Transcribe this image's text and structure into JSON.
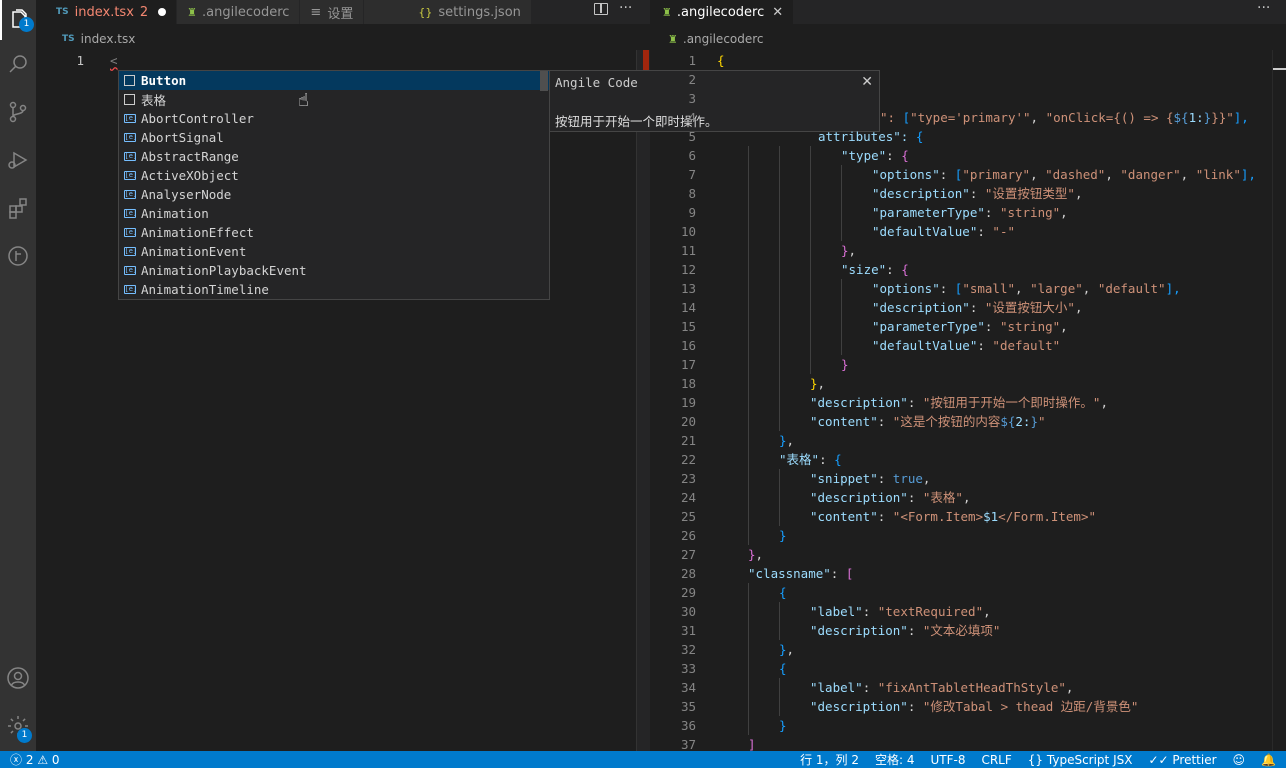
{
  "activity_bar": {
    "explorer_badge": "1",
    "settings_badge": "1"
  },
  "left_editor": {
    "tabs": [
      {
        "icon": "TS",
        "label": "index.tsx",
        "problems": "2"
      },
      {
        "label": ".angilecoderc"
      },
      {
        "icon": "≡",
        "label": "设置"
      },
      {
        "icon": "{}",
        "label": "settings.json"
      }
    ],
    "breadcrumb": {
      "icon": "TS",
      "label": "index.tsx"
    },
    "line_number": "1",
    "code": "<"
  },
  "suggest_widget": {
    "items": [
      {
        "label": "Button",
        "kind": "snippet"
      },
      {
        "label": "表格",
        "kind": "snippet"
      },
      {
        "label": "AbortController",
        "kind": "variable"
      },
      {
        "label": "AbortSignal",
        "kind": "variable"
      },
      {
        "label": "AbstractRange",
        "kind": "variable"
      },
      {
        "label": "ActiveXObject",
        "kind": "variable"
      },
      {
        "label": "AnalyserNode",
        "kind": "variable"
      },
      {
        "label": "Animation",
        "kind": "variable"
      },
      {
        "label": "AnimationEffect",
        "kind": "variable"
      },
      {
        "label": "AnimationEvent",
        "kind": "variable"
      },
      {
        "label": "AnimationPlaybackEvent",
        "kind": "variable"
      },
      {
        "label": "AnimationTimeline",
        "kind": "variable"
      }
    ],
    "detail": {
      "title": "Angile Code",
      "description": "按钮用于开始一个即时操作。"
    }
  },
  "right_editor": {
    "tab": {
      "label": ".angilecoderc"
    },
    "breadcrumb": ".angilecoderc",
    "lines": [
      {
        "n": "1",
        "indent": 0,
        "tokens": [
          [
            "{",
            "#ffd700"
          ]
        ]
      },
      {
        "n": "2",
        "indent": 0,
        "tokens": []
      },
      {
        "n": "3",
        "indent": 0,
        "tokens": []
      },
      {
        "n": "4",
        "indent": 0,
        "tokens": [
          [
            "\": ",
            "#ce9178"
          ],
          [
            "[",
            "#179fff"
          ],
          [
            "\"type='primary'\"",
            "#ce9178"
          ],
          [
            ", ",
            "#d4d4d4"
          ],
          [
            "\"onClick={() => {",
            "#ce9178"
          ],
          [
            "${",
            "#569cd6"
          ],
          [
            "1:",
            "#9cdcfe"
          ],
          [
            "}",
            "#569cd6"
          ],
          [
            "}}\"",
            "#ce9178"
          ],
          [
            "],",
            "#179fff"
          ]
        ]
      },
      {
        "n": "5",
        "indent": 0,
        "tokens": [
          [
            "attributes\": ",
            "#9cdcfe"
          ],
          [
            "{",
            "#179fff"
          ]
        ]
      },
      {
        "n": "6",
        "indent": 4,
        "tokens": [
          [
            "\"type\"",
            "#9cdcfe"
          ],
          [
            ": ",
            "#d4d4d4"
          ],
          [
            "{",
            "#da70d6"
          ]
        ]
      },
      {
        "n": "7",
        "indent": 5,
        "tokens": [
          [
            "\"options\"",
            "#9cdcfe"
          ],
          [
            ": ",
            "#d4d4d4"
          ],
          [
            "[",
            "#179fff"
          ],
          [
            "\"primary\"",
            "#ce9178"
          ],
          [
            ", ",
            "#d4d4d4"
          ],
          [
            "\"dashed\"",
            "#ce9178"
          ],
          [
            ", ",
            "#d4d4d4"
          ],
          [
            "\"danger\"",
            "#ce9178"
          ],
          [
            ", ",
            "#d4d4d4"
          ],
          [
            "\"link\"",
            "#ce9178"
          ],
          [
            "],",
            "#179fff"
          ]
        ]
      },
      {
        "n": "8",
        "indent": 5,
        "tokens": [
          [
            "\"description\"",
            "#9cdcfe"
          ],
          [
            ": ",
            "#d4d4d4"
          ],
          [
            "\"设置按钮类型\"",
            "#ce9178"
          ],
          [
            ",",
            "#d4d4d4"
          ]
        ]
      },
      {
        "n": "9",
        "indent": 5,
        "tokens": [
          [
            "\"parameterType\"",
            "#9cdcfe"
          ],
          [
            ": ",
            "#d4d4d4"
          ],
          [
            "\"string\"",
            "#ce9178"
          ],
          [
            ",",
            "#d4d4d4"
          ]
        ]
      },
      {
        "n": "10",
        "indent": 5,
        "tokens": [
          [
            "\"defaultValue\"",
            "#9cdcfe"
          ],
          [
            ": ",
            "#d4d4d4"
          ],
          [
            "\"-\"",
            "#ce9178"
          ]
        ]
      },
      {
        "n": "11",
        "indent": 4,
        "tokens": [
          [
            "}",
            "#da70d6"
          ],
          [
            ",",
            "#d4d4d4"
          ]
        ]
      },
      {
        "n": "12",
        "indent": 4,
        "tokens": [
          [
            "\"size\"",
            "#9cdcfe"
          ],
          [
            ": ",
            "#d4d4d4"
          ],
          [
            "{",
            "#da70d6"
          ]
        ]
      },
      {
        "n": "13",
        "indent": 5,
        "tokens": [
          [
            "\"options\"",
            "#9cdcfe"
          ],
          [
            ": ",
            "#d4d4d4"
          ],
          [
            "[",
            "#179fff"
          ],
          [
            "\"small\"",
            "#ce9178"
          ],
          [
            ", ",
            "#d4d4d4"
          ],
          [
            "\"large\"",
            "#ce9178"
          ],
          [
            ", ",
            "#d4d4d4"
          ],
          [
            "\"default\"",
            "#ce9178"
          ],
          [
            "],",
            "#179fff"
          ]
        ]
      },
      {
        "n": "14",
        "indent": 5,
        "tokens": [
          [
            "\"description\"",
            "#9cdcfe"
          ],
          [
            ": ",
            "#d4d4d4"
          ],
          [
            "\"设置按钮大小\"",
            "#ce9178"
          ],
          [
            ",",
            "#d4d4d4"
          ]
        ]
      },
      {
        "n": "15",
        "indent": 5,
        "tokens": [
          [
            "\"parameterType\"",
            "#9cdcfe"
          ],
          [
            ": ",
            "#d4d4d4"
          ],
          [
            "\"string\"",
            "#ce9178"
          ],
          [
            ",",
            "#d4d4d4"
          ]
        ]
      },
      {
        "n": "16",
        "indent": 5,
        "tokens": [
          [
            "\"defaultValue\"",
            "#9cdcfe"
          ],
          [
            ": ",
            "#d4d4d4"
          ],
          [
            "\"default\"",
            "#ce9178"
          ]
        ]
      },
      {
        "n": "17",
        "indent": 4,
        "tokens": [
          [
            "}",
            "#da70d6"
          ]
        ]
      },
      {
        "n": "18",
        "indent": 3,
        "tokens": [
          [
            "}",
            "#ffd700"
          ],
          [
            ",",
            "#d4d4d4"
          ]
        ]
      },
      {
        "n": "19",
        "indent": 3,
        "tokens": [
          [
            "\"description\"",
            "#9cdcfe"
          ],
          [
            ": ",
            "#d4d4d4"
          ],
          [
            "\"按钮用于开始一个即时操作。\"",
            "#ce9178"
          ],
          [
            ",",
            "#d4d4d4"
          ]
        ]
      },
      {
        "n": "20",
        "indent": 3,
        "tokens": [
          [
            "\"content\"",
            "#9cdcfe"
          ],
          [
            ": ",
            "#d4d4d4"
          ],
          [
            "\"这是个按钮的内容",
            "#ce9178"
          ],
          [
            "${",
            "#569cd6"
          ],
          [
            "2:",
            "#9cdcfe"
          ],
          [
            "}",
            "#569cd6"
          ],
          [
            "\"",
            "#ce9178"
          ]
        ]
      },
      {
        "n": "21",
        "indent": 2,
        "tokens": [
          [
            "}",
            "#179fff"
          ],
          [
            ",",
            "#d4d4d4"
          ]
        ]
      },
      {
        "n": "22",
        "indent": 2,
        "tokens": [
          [
            "\"表格\"",
            "#9cdcfe"
          ],
          [
            ": ",
            "#d4d4d4"
          ],
          [
            "{",
            "#179fff"
          ]
        ]
      },
      {
        "n": "23",
        "indent": 3,
        "tokens": [
          [
            "\"snippet\"",
            "#9cdcfe"
          ],
          [
            ": ",
            "#d4d4d4"
          ],
          [
            "true",
            "#569cd6"
          ],
          [
            ",",
            "#d4d4d4"
          ]
        ]
      },
      {
        "n": "24",
        "indent": 3,
        "tokens": [
          [
            "\"description\"",
            "#9cdcfe"
          ],
          [
            ": ",
            "#d4d4d4"
          ],
          [
            "\"表格\"",
            "#ce9178"
          ],
          [
            ",",
            "#d4d4d4"
          ]
        ]
      },
      {
        "n": "25",
        "indent": 3,
        "tokens": [
          [
            "\"content\"",
            "#9cdcfe"
          ],
          [
            ": ",
            "#d4d4d4"
          ],
          [
            "\"<Form.Item>",
            "#ce9178"
          ],
          [
            "$1",
            "#9cdcfe"
          ],
          [
            "</Form.Item>\"",
            "#ce9178"
          ]
        ]
      },
      {
        "n": "26",
        "indent": 2,
        "tokens": [
          [
            "}",
            "#179fff"
          ]
        ]
      },
      {
        "n": "27",
        "indent": 1,
        "tokens": [
          [
            "}",
            "#da70d6"
          ],
          [
            ",",
            "#d4d4d4"
          ]
        ]
      },
      {
        "n": "28",
        "indent": 1,
        "tokens": [
          [
            "\"classname\"",
            "#9cdcfe"
          ],
          [
            ": ",
            "#d4d4d4"
          ],
          [
            "[",
            "#da70d6"
          ]
        ]
      },
      {
        "n": "29",
        "indent": 2,
        "tokens": [
          [
            "{",
            "#179fff"
          ]
        ]
      },
      {
        "n": "30",
        "indent": 3,
        "tokens": [
          [
            "\"label\"",
            "#9cdcfe"
          ],
          [
            ": ",
            "#d4d4d4"
          ],
          [
            "\"textRequired\"",
            "#ce9178"
          ],
          [
            ",",
            "#d4d4d4"
          ]
        ]
      },
      {
        "n": "31",
        "indent": 3,
        "tokens": [
          [
            "\"description\"",
            "#9cdcfe"
          ],
          [
            ": ",
            "#d4d4d4"
          ],
          [
            "\"文本必填项\"",
            "#ce9178"
          ]
        ]
      },
      {
        "n": "32",
        "indent": 2,
        "tokens": [
          [
            "}",
            "#179fff"
          ],
          [
            ",",
            "#d4d4d4"
          ]
        ]
      },
      {
        "n": "33",
        "indent": 2,
        "tokens": [
          [
            "{",
            "#179fff"
          ]
        ]
      },
      {
        "n": "34",
        "indent": 3,
        "tokens": [
          [
            "\"label\"",
            "#9cdcfe"
          ],
          [
            ": ",
            "#d4d4d4"
          ],
          [
            "\"fixAntTabletHeadThStyle\"",
            "#ce9178"
          ],
          [
            ",",
            "#d4d4d4"
          ]
        ]
      },
      {
        "n": "35",
        "indent": 3,
        "tokens": [
          [
            "\"description\"",
            "#9cdcfe"
          ],
          [
            ": ",
            "#d4d4d4"
          ],
          [
            "\"修改Tabal > thead 边距/背景色\"",
            "#ce9178"
          ]
        ]
      },
      {
        "n": "36",
        "indent": 2,
        "tokens": [
          [
            "}",
            "#179fff"
          ]
        ]
      },
      {
        "n": "37",
        "indent": 1,
        "tokens": [
          [
            "]",
            "#da70d6"
          ]
        ]
      }
    ]
  },
  "status_bar": {
    "errors": "2",
    "warnings": "0",
    "position": "行 1，列 2",
    "spaces": "空格: 4",
    "encoding": "UTF-8",
    "eol": "CRLF",
    "language": "TypeScript JSX",
    "formatter": "Prettier"
  }
}
